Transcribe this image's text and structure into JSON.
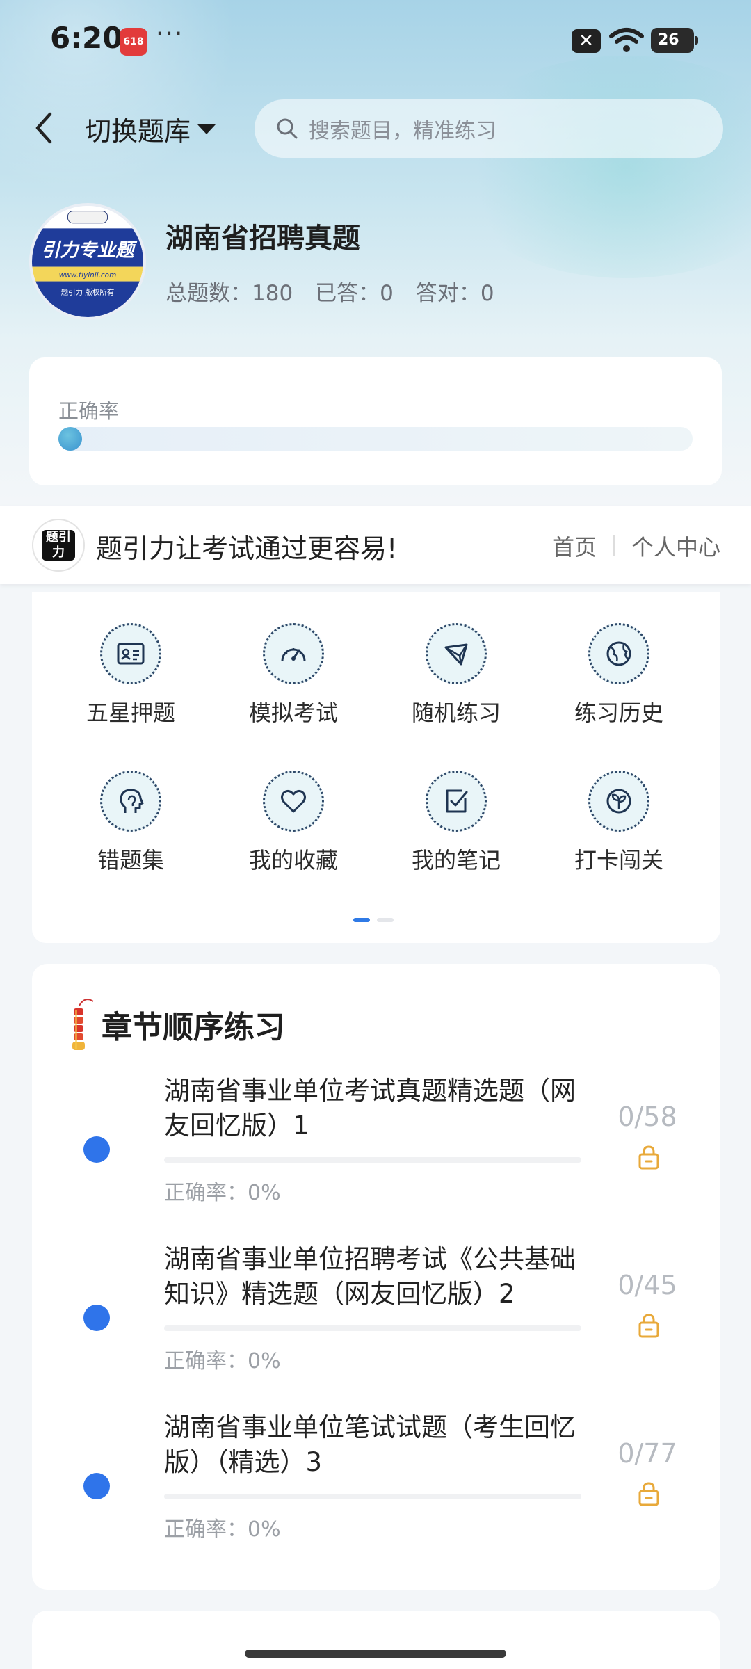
{
  "status_bar": {
    "time": "6:20",
    "badge": "618",
    "dots": "···",
    "battery": "26"
  },
  "nav": {
    "switch_label": "切换题库",
    "search_placeholder": "搜索题目，精准练习"
  },
  "bank": {
    "title": "湖南省招聘真题",
    "logo_text_main": "引力专业题",
    "logo_url": "www.tiyinli.com",
    "logo_copyright": "题引力 版权所有",
    "stats": {
      "total_label": "总题数：",
      "total": "180",
      "answered_label": "已答：",
      "answered": "0",
      "correct_label": "答对：",
      "correct": "0"
    }
  },
  "accuracy": {
    "label": "正确率",
    "value": 0
  },
  "banner": {
    "logo_text": "题引力",
    "slogan": "题引力让考试通过更容易!",
    "links": [
      "首页",
      "个人中心"
    ]
  },
  "grid": [
    {
      "label": "五星押题",
      "icon": "id-card-icon"
    },
    {
      "label": "模拟考试",
      "icon": "speedometer-icon"
    },
    {
      "label": "随机练习",
      "icon": "shuffle-icon"
    },
    {
      "label": "练习历史",
      "icon": "globe-icon"
    },
    {
      "label": "错题集",
      "icon": "head-icon"
    },
    {
      "label": "我的收藏",
      "icon": "heart-icon"
    },
    {
      "label": "我的笔记",
      "icon": "note-check-icon"
    },
    {
      "label": "打卡闯关",
      "icon": "sprout-icon"
    }
  ],
  "chapters": {
    "title": "章节顺序练习",
    "items": [
      {
        "title": "湖南省事业单位考试真题精选题（网友回忆版）1",
        "rate": "正确率：0%",
        "count": "0/58"
      },
      {
        "title": "湖南省事业单位招聘考试《公共基础知识》精选题（网友回忆版）2",
        "rate": "正确率：0%",
        "count": "0/45"
      },
      {
        "title": "湖南省事业单位笔试试题（考生回忆版）（精选）3",
        "rate": "正确率：0%",
        "count": "0/77"
      }
    ]
  },
  "colors": {
    "accent": "#2f74ea",
    "lock": "#e8a93a",
    "knob": "#3a93cf"
  }
}
